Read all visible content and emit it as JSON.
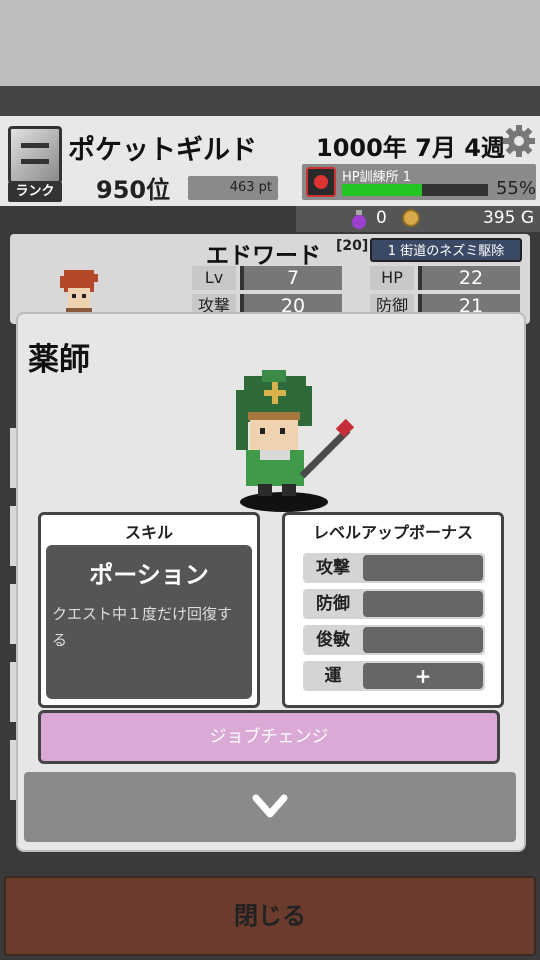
{
  "header": {
    "rank_label": "ランク",
    "guild_name": "ポケットギルド",
    "rank_position": "950位",
    "points": "463 pt",
    "date": "1000年 7月 4週",
    "facility": {
      "name": "HP訓練所 1",
      "progress_percent": "55%",
      "progress": 0.55
    },
    "potions": "0",
    "gold": "395 G"
  },
  "character": {
    "name": "エドワード",
    "level_tag": "[20]",
    "quest": "1 街道のネズミ駆除",
    "stats": [
      {
        "label": "Lv",
        "value": "7"
      },
      {
        "label": "HP",
        "value": "22"
      },
      {
        "label": "攻撃",
        "value": "20"
      },
      {
        "label": "防御",
        "value": "21"
      }
    ]
  },
  "modal": {
    "job_title": "薬師",
    "skill": {
      "heading": "スキル",
      "name": "ポーション",
      "description": "クエスト中１度だけ回復する"
    },
    "bonus": {
      "heading": "レベルアップボーナス",
      "rows": [
        {
          "label": "攻撃",
          "value": ""
        },
        {
          "label": "防御",
          "value": ""
        },
        {
          "label": "俊敏",
          "value": ""
        },
        {
          "label": "運",
          "value": "+"
        }
      ]
    },
    "job_change_label": "ジョブチェンジ"
  },
  "close_label": "閉じる"
}
